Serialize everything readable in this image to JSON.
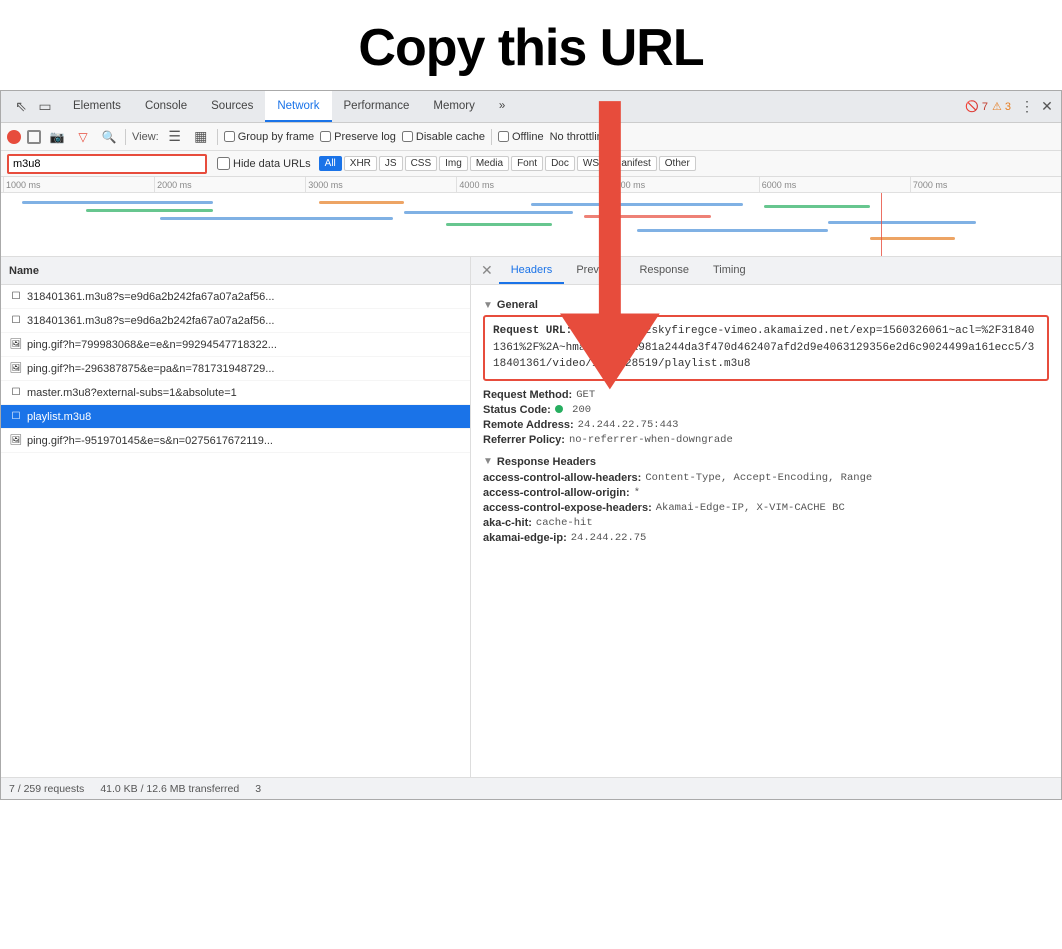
{
  "title": "Copy this URL",
  "devtools": {
    "tabs": [
      {
        "label": "Elements",
        "active": false
      },
      {
        "label": "Console",
        "active": false
      },
      {
        "label": "Sources",
        "active": false
      },
      {
        "label": "Network",
        "active": true
      },
      {
        "label": "Performance",
        "active": false
      },
      {
        "label": "Memory",
        "active": false
      },
      {
        "label": "»",
        "active": false
      }
    ],
    "badge_error": "🚫 7",
    "badge_warn": "⚠ 3",
    "toolbar2": {
      "view_label": "View:",
      "group_by_frame": "Group by frame",
      "preserve_log": "Preserve log",
      "disable_cache": "Disable cache",
      "offline": "Offline",
      "no_throttling": "No throttling"
    },
    "filter": {
      "value": "m3u8",
      "hide_data_urls": "Hide data URLs",
      "types": [
        "All",
        "XHR",
        "JS",
        "CSS",
        "Img",
        "Media",
        "Font",
        "Doc",
        "WS",
        "Manifest",
        "Other"
      ]
    },
    "ruler": [
      "1000 ms",
      "2000 ms",
      "3000 ms",
      "4000 ms",
      "5000 ms",
      "6000 ms",
      "7000 ms"
    ],
    "files": [
      {
        "name": "318401361.m3u8?s=e9d6a2b242fa67a07a2af56...",
        "icon": "doc",
        "selected": false
      },
      {
        "name": "318401361.m3u8?s=e9d6a2b242fa67a07a2af56...",
        "icon": "doc",
        "selected": false
      },
      {
        "name": "ping.gif?h=799983068&e=e&n=99294547718322...",
        "icon": "img",
        "selected": false
      },
      {
        "name": "ping.gif?h=-296387875&e=pa&n=781731948729...",
        "icon": "img",
        "selected": false
      },
      {
        "name": "master.m3u8?external-subs=1&absolute=1",
        "icon": "doc",
        "selected": false
      },
      {
        "name": "playlist.m3u8",
        "icon": "doc",
        "selected": true
      },
      {
        "name": "ping.gif?h=-951970145&e=s&n=0275617672119...",
        "icon": "img",
        "selected": false
      }
    ],
    "detail_tabs": [
      "Headers",
      "Preview",
      "Response",
      "Timing"
    ],
    "detail_active_tab": "Headers",
    "general": {
      "section_title": "General",
      "request_url_label": "Request URL:",
      "request_url_value": "https://162skyfiregce-vimeo.akamaized.net/exp=1560326061~acl=%2F318401361%2F%2A~hmac=c6484a981a244da3f470d462407afd2d9e4063129356e2d6c9024499a161ecc5/318401361/video/1234028519/playlist.m3u8",
      "method_label": "Request Method:",
      "method_value": "GET",
      "status_label": "Status Code:",
      "status_value": "200",
      "remote_label": "Remote Address:",
      "remote_value": "24.244.22.75:443",
      "referrer_label": "Referrer Policy:",
      "referrer_value": "no-referrer-when-downgrade"
    },
    "response_headers": {
      "section_title": "Response Headers",
      "rows": [
        {
          "key": "access-control-allow-headers:",
          "val": "Content-Type, Accept-Encoding, Range"
        },
        {
          "key": "access-control-allow-origin:",
          "val": "*"
        },
        {
          "key": "access-control-expose-headers:",
          "val": "Akamai-Edge-IP, X-VIM-CACHE BC"
        },
        {
          "key": "aka-c-hit:",
          "val": "cache-hit"
        },
        {
          "key": "akamai-edge-ip:",
          "val": "24.244.22.75"
        }
      ]
    },
    "statusbar": {
      "requests": "7 / 259 requests",
      "transfer": "41.0 KB / 12.6 MB transferred",
      "extra": "3"
    }
  }
}
